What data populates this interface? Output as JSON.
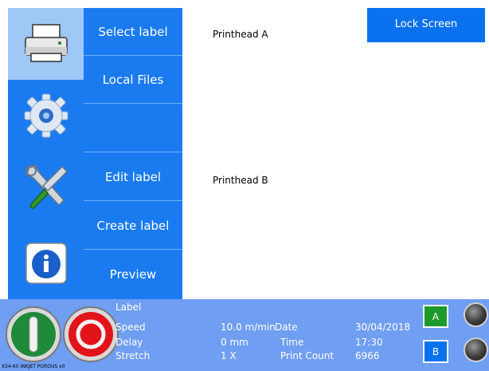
{
  "menu": {
    "items": [
      {
        "label": "Select label"
      },
      {
        "label": "Local Files"
      },
      {
        "label": ""
      },
      {
        "label": "Edit label"
      },
      {
        "label": "Create label"
      },
      {
        "label": "Preview"
      }
    ]
  },
  "icons": [
    "printer-icon",
    "gear-icon",
    "wrench-screwdriver-icon",
    "info-icon"
  ],
  "main": {
    "printhead_a": "Printhead A",
    "printhead_b": "Printhead B",
    "lock_label": "Lock Screen"
  },
  "status": {
    "label_key": "Label",
    "speed_key": "Speed",
    "speed_val": "10.0 m/min",
    "delay_key": "Delay",
    "delay_val": "0 mm",
    "stretch_key": "Stretch",
    "stretch_val": "1 X",
    "date_key": "Date",
    "date_val": "30/04/2018",
    "time_key": "Time",
    "time_val": "17:30",
    "count_key": "Print Count",
    "count_val": "6966",
    "btn_a": "A",
    "btn_b": "B",
    "footer_note": "X54-60 INKJET POROUS x0"
  },
  "colors": {
    "menu_blue": "#1a7bf0",
    "status_blue": "#6f9ef3",
    "start_green": "#1f8a3a",
    "stop_red": "#e3131a",
    "a_button_green": "#1c9a2a",
    "b_button_blue": "#0a72ee"
  }
}
